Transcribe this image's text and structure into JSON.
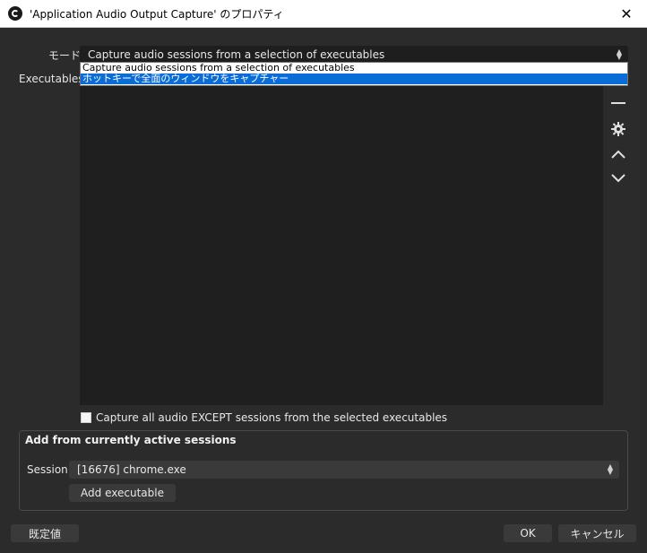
{
  "window": {
    "title": "'Application Audio Output Capture' のプロパティ",
    "close_glyph": "✕"
  },
  "mode": {
    "label": "モード",
    "value": "Capture audio sessions from a selection of executables",
    "options": [
      "Capture audio sessions from a selection of executables",
      "ホットキーで全面のウィンドウをキャプチャー"
    ],
    "highlighted_index": 1
  },
  "executables": {
    "label": "Executables",
    "items": [],
    "side_buttons": {
      "remove": "—",
      "settings": "⚙",
      "up": "⌃",
      "down": "⌄"
    }
  },
  "except_checkbox": {
    "label": "Capture all audio EXCEPT sessions from the selected executables",
    "checked": false
  },
  "active_sessions": {
    "title": "Add from currently active sessions",
    "session_label": "Session",
    "session_value": "[16676] chrome.exe",
    "add_button": "Add executable"
  },
  "footer": {
    "defaults_button": "既定値",
    "ok_button": "OK",
    "cancel_button": "キャンセル"
  }
}
